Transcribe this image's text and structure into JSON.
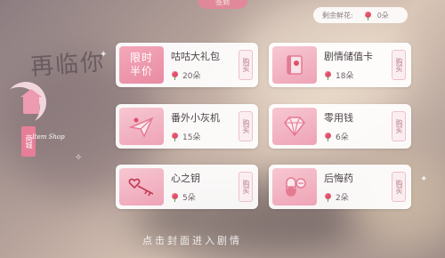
{
  "top_tab": "签到",
  "background": {
    "title": "再临你",
    "hint": "点击封面进入剧情"
  },
  "counter": {
    "label": "剩余鲜花:",
    "value": "0朵",
    "icon": "rose-icon"
  },
  "shop_logo": {
    "tag": "商城",
    "script": "Item Shop"
  },
  "items": [
    {
      "name": "咕咕大礼包",
      "price": "20朵",
      "buy_label": "购买",
      "icon": "sale-badge",
      "badge_line1": "限时",
      "badge_line2": "半价"
    },
    {
      "name": "剧情储值卡",
      "price": "18朵",
      "buy_label": "购买",
      "icon": "book-icon"
    },
    {
      "name": "番外小灰机",
      "price": "15朵",
      "buy_label": "购买",
      "icon": "plane-icon"
    },
    {
      "name": "零用钱",
      "price": "6朵",
      "buy_label": "购买",
      "icon": "diamond-icon"
    },
    {
      "name": "心之钥",
      "price": "5朵",
      "buy_label": "购买",
      "icon": "heart-key-icon"
    },
    {
      "name": "后悔药",
      "price": "2朵",
      "buy_label": "购买",
      "icon": "pill-icon"
    }
  ],
  "colors": {
    "accent": "#e77e98",
    "card": "#ffffff",
    "rose": "#e0506b"
  }
}
